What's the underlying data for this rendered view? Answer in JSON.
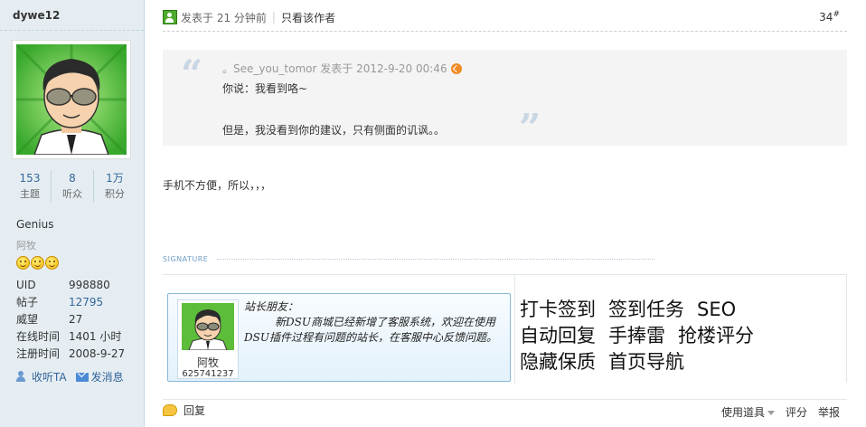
{
  "author": {
    "name": "dywe12",
    "stats": [
      {
        "value": "153",
        "label": "主题"
      },
      {
        "value": "8",
        "label": "听众"
      },
      {
        "value": "1万",
        "label": "积分"
      }
    ],
    "group": "Genius",
    "nickname": "阿牧",
    "medal_icons": [
      "smile-icon",
      "smile-icon",
      "smile-icon"
    ],
    "info": [
      {
        "key": "UID",
        "value": "998880"
      },
      {
        "key": "帖子",
        "value": "12795"
      },
      {
        "key": "威望",
        "value": "27"
      },
      {
        "key": "在线时间",
        "value": "1401 小时"
      },
      {
        "key": "注册时间",
        "value": "2008-9-27"
      }
    ],
    "follow_label": "收听TA",
    "message_label": "发消息"
  },
  "post": {
    "posted_time": "发表于 21 分钟前",
    "only_author_label": "只看该作者",
    "floor": "34",
    "floor_sup": "#",
    "quote": {
      "header": "。See_you_tomor 发表于 2012-9-20 00:46",
      "line1": "你说：我看到咯~",
      "line2": "但是，我没看到你的建议，只有侧面的讥讽。。",
      "open_mark": "“",
      "close_mark": "”"
    },
    "message": "手机不方便，所以，，，",
    "signature_label": "SIGNATURE"
  },
  "signature": {
    "nick": "阿牧",
    "qq": "625741237",
    "text_greeting": "站长朋友：",
    "text_body": "新DSU商城已经新增了客服系统，欢迎在使用DSU插件过程有问题的站长，在客服中心反馈问题。",
    "links": [
      [
        "打卡签到",
        "签到任务",
        "SEO"
      ],
      [
        "自动回复",
        "手捧雷",
        "抢楼评分"
      ],
      [
        "隐藏保质",
        "首页导航"
      ]
    ]
  },
  "footer": {
    "reply_label": "回复",
    "tools_label": "使用道具",
    "rate_label": "评分",
    "report_label": "举报"
  },
  "colors": {
    "sidebar_bg": "#e5edf2",
    "link": "#336699",
    "quote_bg": "#f4f4f4"
  }
}
